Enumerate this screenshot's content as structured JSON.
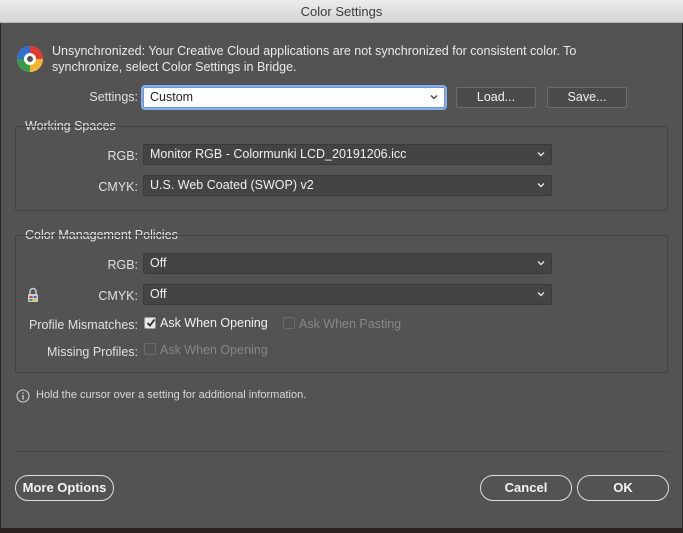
{
  "window": {
    "title": "Color Settings"
  },
  "sync": {
    "message_line1": "Unsynchronized: Your Creative Cloud applications are not synchronized for consistent color. To",
    "message_line2": "synchronize, select Color Settings in Bridge."
  },
  "settings": {
    "label": "Settings:",
    "value": "Custom",
    "load_label": "Load...",
    "save_label": "Save..."
  },
  "working_spaces": {
    "title": "Working Spaces",
    "rgb_label": "RGB:",
    "rgb_value": "Monitor RGB - Colormunki LCD_20191206.icc",
    "cmyk_label": "CMYK:",
    "cmyk_value": "U.S. Web Coated (SWOP) v2"
  },
  "policies": {
    "title": "Color Management Policies",
    "rgb_label": "RGB:",
    "rgb_value": "Off",
    "cmyk_label": "CMYK:",
    "cmyk_value": "Off",
    "mismatch_label": "Profile Mismatches:",
    "ask_opening_label": "Ask When Opening",
    "ask_opening_checked": true,
    "ask_pasting_label": "Ask When Pasting",
    "ask_pasting_checked": false,
    "missing_label": "Missing Profiles:",
    "missing_opening_label": "Ask When Opening",
    "missing_opening_checked": false
  },
  "info": {
    "text": "Hold the cursor over a setting for additional information."
  },
  "footer": {
    "more_options_label": "More Options",
    "cancel_label": "Cancel",
    "ok_label": "OK"
  },
  "icons": {
    "sync": "sync-color-wheel-icon",
    "lock": "lock-icon",
    "info": "info-icon",
    "chevron": "chevron-down-icon",
    "check": "checkmark-icon"
  },
  "colors": {
    "dialog_bg": "#535353",
    "focus_ring": "#86aee8"
  }
}
